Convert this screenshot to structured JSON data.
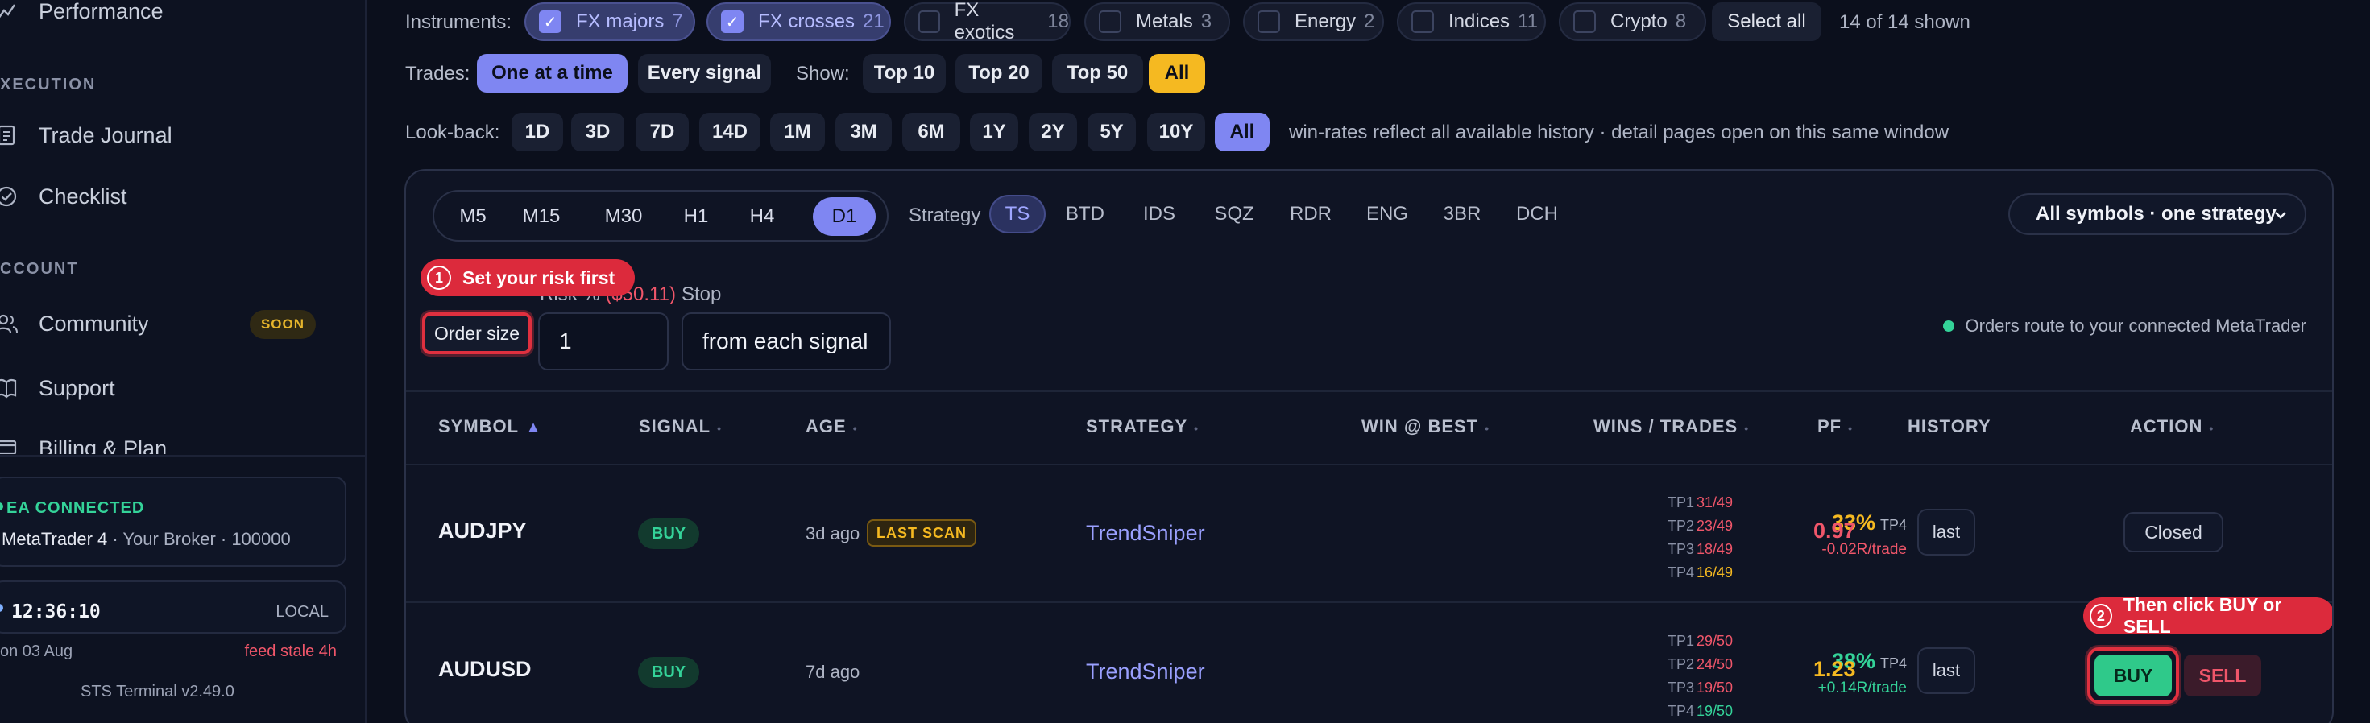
{
  "sidebar": {
    "performance": "Performance",
    "execution_head": "XECUTION",
    "trade_journal": "Trade Journal",
    "checklist": "Checklist",
    "account_head": "CCOUNT",
    "community": "Community",
    "soon": "SOON",
    "support": "Support",
    "billing": "Billing & Plan",
    "ea_status": "EA CONNECTED",
    "ea_platform": "MetaTrader 4",
    "ea_detail": " · Your Broker · 100000",
    "clock": "12:36:10",
    "clock_zone": "LOCAL",
    "date": "on 03 Aug",
    "stale": "feed stale 4h",
    "version": "STS Terminal v2.49.0"
  },
  "filters": {
    "instruments_label": "Instruments:",
    "instruments": [
      {
        "label": "FX majors",
        "count": "7",
        "checked": true
      },
      {
        "label": "FX crosses",
        "count": "21",
        "checked": true
      },
      {
        "label": "FX exotics",
        "count": "18",
        "checked": false
      },
      {
        "label": "Metals",
        "count": "3",
        "checked": false
      },
      {
        "label": "Energy",
        "count": "2",
        "checked": false
      },
      {
        "label": "Indices",
        "count": "11",
        "checked": false
      },
      {
        "label": "Crypto",
        "count": "8",
        "checked": false
      }
    ],
    "select_all": "Select all",
    "shown": "14 of 14 shown",
    "trades_label": "Trades:",
    "trades_one": "One at a time",
    "trades_every": "Every signal",
    "show_label": "Show:",
    "show_options": [
      "Top 10",
      "Top 20",
      "Top 50",
      "All"
    ],
    "lookback_label": "Look-back:",
    "lookback_options": [
      "1D",
      "3D",
      "7D",
      "14D",
      "1M",
      "3M",
      "6M",
      "1Y",
      "2Y",
      "5Y",
      "10Y",
      "All"
    ],
    "lookback_note": "win-rates reflect all available history · detail pages open on this same window"
  },
  "panel": {
    "timeframes": [
      "M5",
      "M15",
      "M30",
      "H1",
      "H4",
      "D1"
    ],
    "strategy_label": "Strategy",
    "strategies": [
      "TS",
      "BTD",
      "IDS",
      "SQZ",
      "RDR",
      "ENG",
      "3BR",
      "DCH"
    ],
    "mode": "All symbols · one strategy",
    "callout1_num": "1",
    "callout1": "Set your risk first",
    "callout2_num": "2",
    "callout2": "Then click BUY or SELL",
    "risk_label": "Risk %",
    "risk_hint": "($50.11)",
    "stop_label": "Stop",
    "order_size": "Order size",
    "risk_value": "1",
    "stop_value": "from each signal",
    "route": "Orders route to your connected MetaTrader"
  },
  "table": {
    "headers": {
      "symbol": "SYMBOL",
      "signal": "SIGNAL",
      "age": "AGE",
      "strategy": "STRATEGY",
      "win": "WIN @ BEST",
      "wins": "WINS / TRADES",
      "pf": "PF",
      "history": "HISTORY",
      "action": "ACTION"
    },
    "rows": [
      {
        "symbol": "AUDJPY",
        "signal": "BUY",
        "age": "3d ago",
        "badge": "LAST SCAN",
        "strategy": "TrendSniper",
        "win_pct": "33%",
        "win_tp": "TP4",
        "r_per_trade": "-0.02R/trade",
        "tps": [
          [
            "TP1",
            "31/49"
          ],
          [
            "TP2",
            "23/49"
          ],
          [
            "TP3",
            "18/49"
          ],
          [
            "TP4",
            "16/49"
          ]
        ],
        "pf": "0.97",
        "history": "last",
        "action": "Closed"
      },
      {
        "symbol": "AUDUSD",
        "signal": "BUY",
        "age": "7d ago",
        "strategy": "TrendSniper",
        "win_pct": "38%",
        "win_tp": "TP4",
        "r_per_trade": "+0.14R/trade",
        "tps": [
          [
            "TP1",
            "29/50"
          ],
          [
            "TP2",
            "24/50"
          ],
          [
            "TP3",
            "19/50"
          ],
          [
            "TP4",
            "19/50"
          ]
        ],
        "pf": "1.23",
        "history": "last",
        "buy": "BUY",
        "sell": "SELL"
      }
    ]
  },
  "colors": {
    "accent": "#7f86f2",
    "gold": "#f5b921",
    "green": "#34d399",
    "red": "#f0566a",
    "callout_red": "#dc2a3c"
  }
}
